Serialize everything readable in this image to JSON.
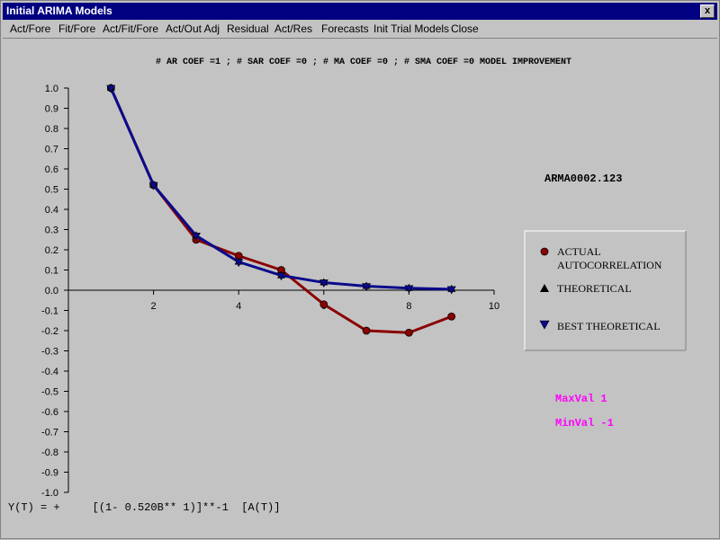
{
  "window": {
    "title": "Initial ARIMA Models",
    "close_label": "x"
  },
  "menu": [
    "Act/Fore",
    "Fit/Fore",
    "Act/Fit/Fore",
    "Act/Out Adj",
    "Residual",
    "Act/Res",
    "Forecasts",
    "Init Trial Models",
    "Close"
  ],
  "chart_data": {
    "type": "line",
    "title": "# AR COEF =1 ; # SAR COEF =0 ; # MA COEF =0 ; # SMA COEF =0 MODEL IMPROVEMENT",
    "xlim": [
      0,
      10
    ],
    "ylim": [
      -1.0,
      1.0
    ],
    "x_ticks": [
      2,
      4,
      6,
      8,
      10
    ],
    "y_ticks": [
      "1.0",
      "0.9",
      "0.8",
      "0.7",
      "0.6",
      "0.5",
      "0.4",
      "0.3",
      "0.2",
      "0.1",
      "0.0",
      "-0.1",
      "-0.2",
      "-0.3",
      "-0.4",
      "-0.5",
      "-0.6",
      "-0.7",
      "-0.8",
      "-0.9",
      "-1.0"
    ],
    "series": [
      {
        "name": "ACTUAL AUTOCORRELATION",
        "color": "#8b0000",
        "marker": "circle",
        "x": [
          1,
          2,
          3,
          4,
          5,
          6,
          7,
          8,
          9
        ],
        "y": [
          1.0,
          0.52,
          0.25,
          0.17,
          0.1,
          -0.07,
          -0.2,
          -0.21,
          -0.13
        ]
      },
      {
        "name": "THEORETICAL",
        "color": "#000000",
        "marker": "triangle-up",
        "x": [
          1,
          2,
          3,
          4,
          5,
          6,
          7,
          8,
          9
        ],
        "y": [
          1.0,
          0.52,
          0.27,
          0.14,
          0.073,
          0.038,
          0.02,
          0.01,
          0.005
        ]
      },
      {
        "name": "BEST THEORETICAL",
        "color": "#0a0a8c",
        "marker": "triangle-down",
        "x": [
          1,
          2,
          3,
          4,
          5,
          6,
          7,
          8,
          9
        ],
        "y": [
          1.0,
          0.52,
          0.27,
          0.14,
          0.073,
          0.038,
          0.02,
          0.01,
          0.005
        ]
      }
    ],
    "legend_position": "right",
    "legend_labels": {
      "actual_line1": "ACTUAL",
      "actual_line2": "AUTOCORRELATION",
      "theoretical": "THEORETICAL",
      "best": "BEST THEORETICAL"
    },
    "annotations": {
      "series_id": "ARMA0002.123",
      "maxval": "MaxVal 1",
      "minval": "MinVal -1",
      "equation": "Y(T) = +     [(1- 0.520B** 1)]**-1  [A(T)]"
    },
    "annotation_color": "#ff00ff"
  }
}
